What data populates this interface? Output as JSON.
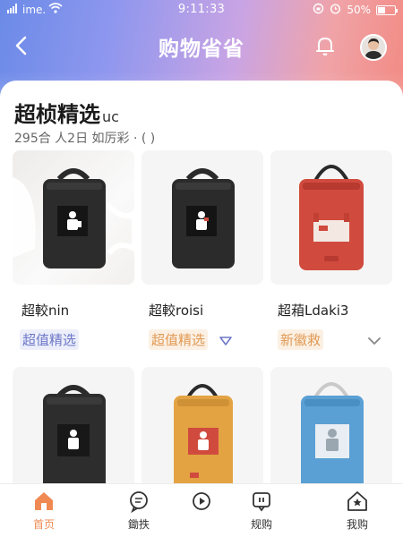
{
  "status_bar": {
    "carrier": "ime.",
    "time": "9:11:33",
    "battery": "50%"
  },
  "nav": {
    "title": "购物省省"
  },
  "section": {
    "heading": "超桢精选",
    "heading_suffix": "uc",
    "subtitle": "295合 人2日 如厉彩 · ( )"
  },
  "products": [
    {
      "name": "超較nin",
      "tag": "超值精选",
      "tag_color": "blue",
      "bag_color": "#2c2c2c"
    },
    {
      "name": "超較roisi",
      "tag": "超值精选",
      "tag_color": "orange",
      "bag_color": "#2b2b2b"
    },
    {
      "name": "超葙Ldaki3",
      "tag": "新徽救",
      "tag_color": "orange",
      "bag_color": "#d04b3e"
    },
    {
      "name": "",
      "tag": "",
      "tag_color": "",
      "bag_color": "#2d2d2d"
    },
    {
      "name": "",
      "tag": "",
      "tag_color": "",
      "bag_color": "#e3a343"
    },
    {
      "name": "",
      "tag": "",
      "tag_color": "",
      "bag_color": "#5aa0d4"
    }
  ],
  "tabs": [
    {
      "label": "首页",
      "icon": "home-icon",
      "active": true
    },
    {
      "label": "鋤抶",
      "icon": "chat-icon",
      "active": false
    },
    {
      "label": "",
      "icon": "play-icon",
      "active": false
    },
    {
      "label": "规购",
      "icon": "message-icon",
      "active": false
    },
    {
      "label": "我购",
      "icon": "profile-icon",
      "active": false
    }
  ],
  "colors": {
    "accent": "#f08a52",
    "tag_blue": "#6d78c8",
    "tag_orange": "#e19a55"
  }
}
